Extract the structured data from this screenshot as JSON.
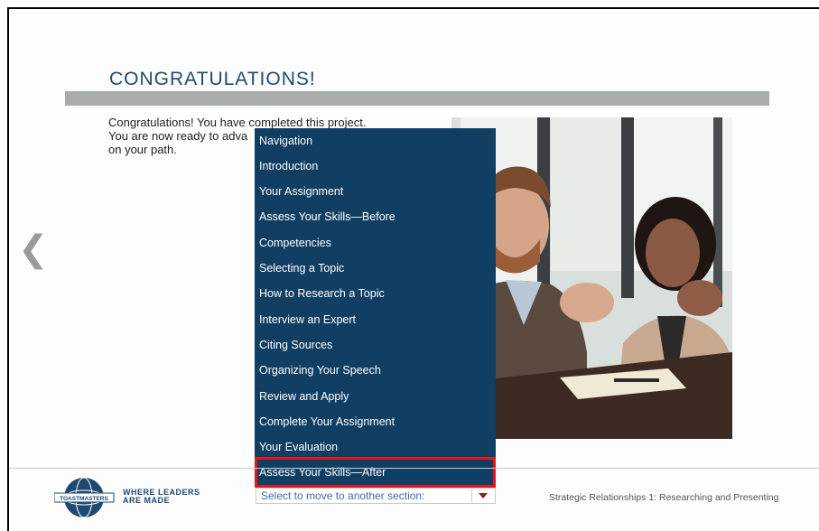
{
  "page": {
    "title": "CONGRATULATIONS!",
    "intro_lines": [
      "Congratulations! You have completed this project.",
      "You are now ready to adva",
      "on your path."
    ]
  },
  "navigation_menu": {
    "items": [
      {
        "label": "Navigation"
      },
      {
        "label": "Introduction"
      },
      {
        "label": "Your Assignment"
      },
      {
        "label": "Assess Your Skills—Before"
      },
      {
        "label": "Competencies"
      },
      {
        "label": "Selecting a Topic"
      },
      {
        "label": "How to Research a Topic"
      },
      {
        "label": "Interview an Expert"
      },
      {
        "label": "Citing Sources"
      },
      {
        "label": "Organizing Your Speech"
      },
      {
        "label": "Review and Apply"
      },
      {
        "label": "Complete Your Assignment"
      },
      {
        "label": "Your Evaluation"
      },
      {
        "label": "Assess Your Skills—After",
        "selected": true
      }
    ]
  },
  "footer": {
    "logo_text": "TOASTMASTERS INTERNATIONAL",
    "tagline_line1": "WHERE LEADERS",
    "tagline_line2": "ARE MADE",
    "select_placeholder": "Select to move to another section:",
    "course_title": "Strategic Relationships 1: Researching and Presenting"
  },
  "icons": {
    "back": "chevron-left-icon",
    "dropdown": "caret-down-icon"
  },
  "colors": {
    "menu_background": "#113e63",
    "selected_outline": "#e8161b",
    "title": "#1f4a70"
  }
}
